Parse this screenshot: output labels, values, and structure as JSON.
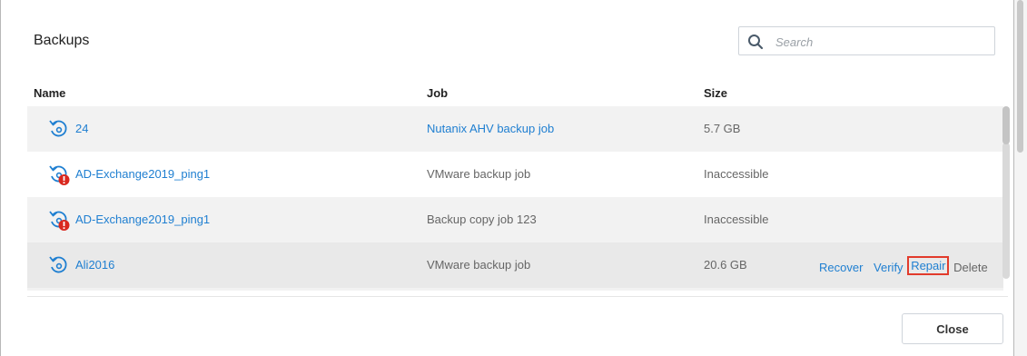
{
  "dialog": {
    "title": "Backups"
  },
  "search": {
    "placeholder": "Search",
    "value": ""
  },
  "columns": {
    "name": "Name",
    "job": "Job",
    "size": "Size"
  },
  "rows": [
    {
      "name": "24",
      "job": "Nutanix AHV backup job",
      "job_is_link": true,
      "size": "5.7 GB",
      "error": false
    },
    {
      "name": "AD-Exchange2019_ping1",
      "job": "VMware backup job",
      "job_is_link": false,
      "size": "Inaccessible",
      "error": true
    },
    {
      "name": "AD-Exchange2019_ping1",
      "job": "Backup copy job 123",
      "job_is_link": false,
      "size": "Inaccessible",
      "error": true
    },
    {
      "name": "Ali2016",
      "job": "VMware backup job",
      "job_is_link": false,
      "size": "20.6 GB",
      "error": false
    }
  ],
  "row_actions": {
    "recover": "Recover",
    "verify": "Verify",
    "repair": "Repair",
    "delete": "Delete"
  },
  "footer": {
    "close_label": "Close"
  },
  "colors": {
    "link": "#1f7fd1",
    "highlight": "#e23b2c",
    "error": "#d9281f"
  }
}
